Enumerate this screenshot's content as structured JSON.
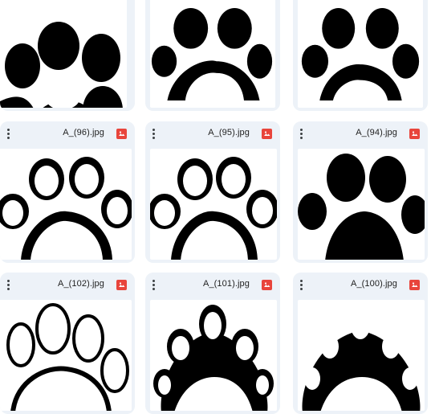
{
  "files": [
    {
      "name": "A_(96).jpg",
      "type_icon": "image-icon"
    },
    {
      "name": "A_(95).jpg",
      "type_icon": "image-icon"
    },
    {
      "name": "A_(94).jpg",
      "type_icon": "image-icon"
    },
    {
      "name": "A_(102).jpg",
      "type_icon": "image-icon"
    },
    {
      "name": "A_(101).jpg",
      "type_icon": "image-icon"
    },
    {
      "name": "A_(100).jpg",
      "type_icon": "image-icon"
    }
  ],
  "colors": {
    "card_bg": "#edf2f8",
    "image_icon": "#e8453c",
    "paw": "#000000"
  }
}
